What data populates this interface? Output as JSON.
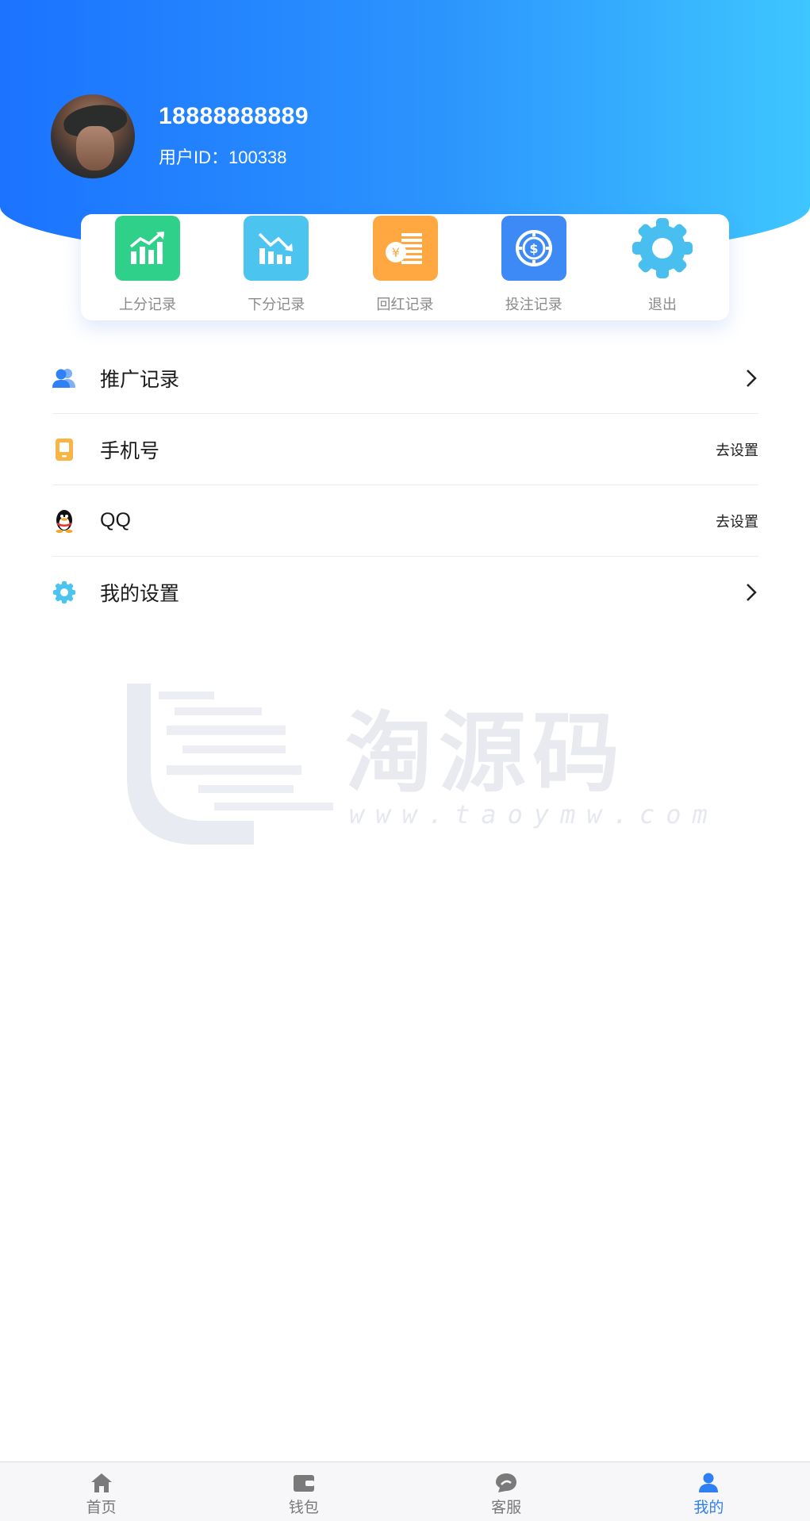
{
  "header": {
    "phone": "18888888889",
    "user_id_label": "用户ID：",
    "user_id": "100338",
    "gradient_start": "#1b73ff",
    "gradient_end": "#3ec6ff"
  },
  "quick_actions": [
    {
      "label": "上分记录",
      "icon": "chart-up-icon",
      "color": "#2ed08a"
    },
    {
      "label": "下分记录",
      "icon": "chart-down-icon",
      "color": "#4cc4f0"
    },
    {
      "label": "回红记录",
      "icon": "coin-stack-icon",
      "color": "#ffa841"
    },
    {
      "label": "投注记录",
      "icon": "dollar-chip-icon",
      "color": "#3d8af7"
    },
    {
      "label": "退出",
      "icon": "gear-icon",
      "color": "#49bff0"
    }
  ],
  "menu": [
    {
      "label": "推广记录",
      "icon": "users-icon",
      "action": "",
      "chevron": true
    },
    {
      "label": "手机号",
      "icon": "mobile-icon",
      "action": "去设置",
      "chevron": false
    },
    {
      "label": "QQ",
      "icon": "qq-penguin-icon",
      "action": "去设置",
      "chevron": false
    },
    {
      "label": "我的设置",
      "icon": "settings-gear-icon",
      "action": "",
      "chevron": true
    }
  ],
  "watermark": {
    "text": "淘源码",
    "url": "www.taoymw.com"
  },
  "tabbar": {
    "active_index": 3,
    "active_color": "#2f7ff5",
    "items": [
      {
        "label": "首页",
        "icon": "home-icon"
      },
      {
        "label": "钱包",
        "icon": "wallet-icon"
      },
      {
        "label": "客服",
        "icon": "chat-icon"
      },
      {
        "label": "我的",
        "icon": "user-icon"
      }
    ]
  }
}
